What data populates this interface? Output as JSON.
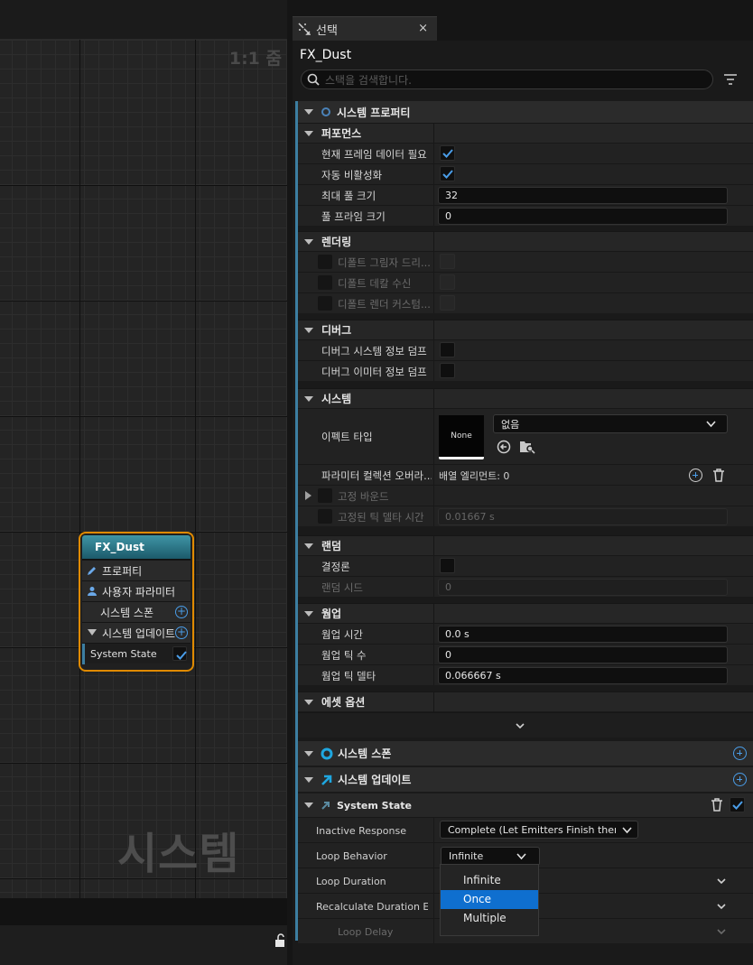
{
  "graph": {
    "zoom_label": "1:1 줌",
    "watermark": "시스템",
    "node": {
      "title": "FX_Dust",
      "rows": [
        "프로퍼티",
        "사용자 파라미터",
        "시스템 스폰",
        "시스템 업데이트"
      ],
      "state_label": "System State"
    }
  },
  "panel": {
    "tab_label": "선택",
    "tab_close": "×",
    "title": "FX_Dust",
    "search_placeholder": "스택을 검색합니다.",
    "system_properties": {
      "header": "시스템 프로퍼티",
      "performance": {
        "label": "퍼포먼스",
        "rows": [
          {
            "label": "현재 프레임 데이터 필요",
            "type": "check",
            "checked": true
          },
          {
            "label": "자동 비활성화",
            "type": "check",
            "checked": true
          },
          {
            "label": "최대 풀 크기",
            "type": "num",
            "value": "32"
          },
          {
            "label": "풀 프라임 크기",
            "type": "num",
            "value": "0"
          }
        ]
      },
      "rendering": {
        "label": "렌더링",
        "rows": [
          {
            "label": "디폴트 그림자 드리...",
            "type": "check_dim",
            "checked": false
          },
          {
            "label": "디폴트 데칼 수신",
            "type": "check_dim",
            "checked": false
          },
          {
            "label": "디폴트 렌더 커스텀...",
            "type": "check_dim",
            "checked": false
          }
        ]
      },
      "debug": {
        "label": "디버그",
        "rows": [
          {
            "label": "디버그 시스템 정보 덤프",
            "type": "check",
            "checked": false
          },
          {
            "label": "디버그 이미터 정보 덤프",
            "type": "check",
            "checked": false
          }
        ]
      },
      "system": {
        "label": "시스템",
        "effect_type_label": "이펙트 타입",
        "thumbnail_text": "None",
        "effect_dropdown_value": "없음",
        "param_collection_label": "파라미터 컬렉션 오버라...",
        "array_elements": "배열 엘리먼트: 0",
        "fixed_bounds_label": "고정 바운드",
        "fixed_tick_label": "고정된 틱 델타 시간",
        "fixed_tick_value": "0.01667 s"
      },
      "random": {
        "label": "랜덤",
        "deterministic_label": "결정론",
        "seed_label": "랜덤 시드",
        "seed_value": "0"
      },
      "warmup": {
        "label": "웜업",
        "rows": [
          {
            "label": "웜업 시간",
            "value": "0.0 s"
          },
          {
            "label": "웜업 틱 수",
            "value": "0"
          },
          {
            "label": "웜업 틱 델타",
            "value": "0.066667 s"
          }
        ]
      },
      "asset_options_label": "에셋 옵션"
    },
    "system_spawn_header": "시스템 스폰",
    "system_update_header": "시스템 업데이트",
    "system_state": {
      "header": "System State",
      "inactive_response_label": "Inactive Response",
      "inactive_response_value": "Complete (Let Emitters Finish then Kill)",
      "loop_behavior_label": "Loop Behavior",
      "loop_behavior_value": "Infinite",
      "loop_duration_label": "Loop Duration",
      "recalc_label": "Recalculate Duration Each Loop",
      "loop_delay_label": "Loop Delay",
      "options": [
        "Infinite",
        "Once",
        "Multiple"
      ],
      "highlighted_option": "Once"
    }
  },
  "colors": {
    "accent_blue": "#0f6fcf",
    "node_border": "#e08a00",
    "check_blue": "#4a9de8"
  }
}
